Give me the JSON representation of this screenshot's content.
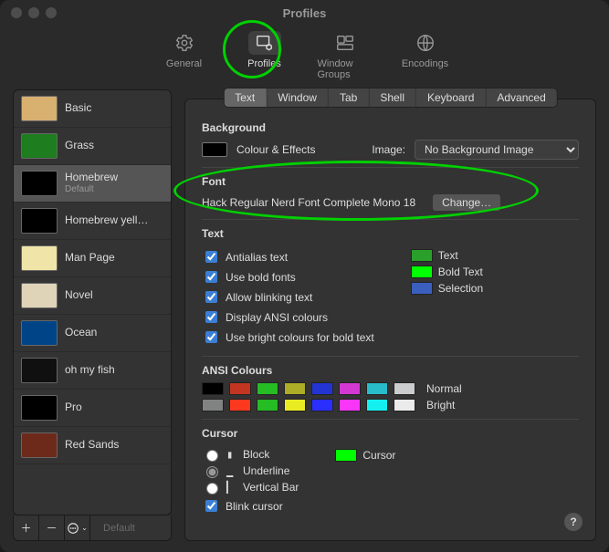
{
  "window": {
    "title": "Profiles"
  },
  "toolbar": {
    "items": [
      {
        "label": "General",
        "icon": "gear-icon"
      },
      {
        "label": "Profiles",
        "icon": "profile-gear-icon"
      },
      {
        "label": "Window Groups",
        "icon": "window-groups-icon"
      },
      {
        "label": "Encodings",
        "icon": "globe-icon"
      }
    ],
    "active": 1
  },
  "sidebar": {
    "items": [
      {
        "name": "Basic",
        "thumb": "th-basic"
      },
      {
        "name": "Grass",
        "thumb": "th-grass"
      },
      {
        "name": "Homebrew",
        "thumb": "th-homebrew",
        "subtitle": "Default",
        "selected": true
      },
      {
        "name": "Homebrew yell…",
        "thumb": "th-hby"
      },
      {
        "name": "Man Page",
        "thumb": "th-man"
      },
      {
        "name": "Novel",
        "thumb": "th-novel"
      },
      {
        "name": "Ocean",
        "thumb": "th-ocean"
      },
      {
        "name": "oh my fish",
        "thumb": "th-omf"
      },
      {
        "name": "Pro",
        "thumb": "th-pro"
      },
      {
        "name": "Red Sands",
        "thumb": "th-red"
      }
    ],
    "default_button": "Default"
  },
  "tabs": {
    "items": [
      "Text",
      "Window",
      "Tab",
      "Shell",
      "Keyboard",
      "Advanced"
    ],
    "active": 0
  },
  "text_pane": {
    "background": {
      "header": "Background",
      "colour_effects_label": "Colour & Effects",
      "colour_effects_swatch": "#000000",
      "image_label": "Image:",
      "image_select": "No Background Image"
    },
    "font": {
      "header": "Font",
      "value": "Hack Regular Nerd Font Complete Mono 18",
      "change_button": "Change…"
    },
    "text": {
      "header": "Text",
      "checks": [
        {
          "label": "Antialias text",
          "checked": true
        },
        {
          "label": "Use bold fonts",
          "checked": true
        },
        {
          "label": "Allow blinking text",
          "checked": true
        },
        {
          "label": "Display ANSI colours",
          "checked": true
        },
        {
          "label": "Use bright colours for bold text",
          "checked": true
        }
      ],
      "samples": [
        {
          "label": "Text",
          "colour": "#2aa02a"
        },
        {
          "label": "Bold Text",
          "colour": "#00ff00"
        },
        {
          "label": "Selection",
          "colour": "#3a5fbf"
        }
      ]
    },
    "ansi": {
      "header": "ANSI Colours",
      "normal_label": "Normal",
      "bright_label": "Bright",
      "normal": [
        "#000000",
        "#c23621",
        "#25bc24",
        "#adad27",
        "#2234d1",
        "#d338d3",
        "#28bbc9",
        "#cbcccd"
      ],
      "bright": [
        "#818383",
        "#fc391f",
        "#25bc24",
        "#eaec23",
        "#2a2fff",
        "#f935f8",
        "#14f0f0",
        "#ebebeb"
      ]
    },
    "cursor": {
      "header": "Cursor",
      "options": [
        {
          "label": "Block",
          "glyph": "▮",
          "selected": false
        },
        {
          "label": "Underline",
          "glyph": "▁",
          "selected": true
        },
        {
          "label": "Vertical Bar",
          "glyph": "▎",
          "selected": false
        }
      ],
      "blink": {
        "label": "Blink cursor",
        "checked": true
      },
      "sample": {
        "label": "Cursor",
        "colour": "#00ff00"
      }
    }
  }
}
